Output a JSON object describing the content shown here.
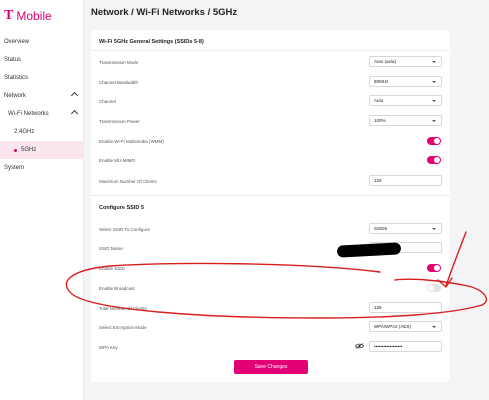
{
  "brand": {
    "logo_mark": "T",
    "name": "Mobile",
    "color": "#e20074"
  },
  "page": {
    "title": "Network / Wi-Fi Networks / 5GHz"
  },
  "sidebar": {
    "items": [
      {
        "label": "Overview"
      },
      {
        "label": "Status"
      },
      {
        "label": "Statistics"
      },
      {
        "label": "Network",
        "expanded": true
      },
      {
        "label": "Wi-Fi Networks",
        "expanded": true
      },
      {
        "label": "2.4GHz"
      },
      {
        "label": "5GHz",
        "active": true
      },
      {
        "label": "System"
      }
    ]
  },
  "general": {
    "title": "Wi-Fi 5GHz General Settings (SSIDs 5-8)",
    "transmission_mode": {
      "label": "Transmission Mode",
      "value": "Auto (ax/a)"
    },
    "channel_bandwidth": {
      "label": "Channel Bandwidth",
      "value": "80MHz"
    },
    "channel": {
      "label": "Channel",
      "value": "Auto"
    },
    "transmission_power": {
      "label": "Transmission Power",
      "value": "100%"
    },
    "wmm": {
      "label": "Enable Wi-Fi Multimedia (WMM)",
      "enabled": true
    },
    "mu_mimo": {
      "label": "Enable MU-MIMO",
      "enabled": true
    },
    "max_clients": {
      "label": "Maximum Number Of Clients",
      "value": "128"
    }
  },
  "ssid": {
    "title": "Configure SSID 5",
    "select_ssid": {
      "label": "Select SSID To Configure",
      "value": "SSID5"
    },
    "ssid_name": {
      "label": "SSID Name",
      "value": ""
    },
    "enable_ssid": {
      "label": "Enable SSID",
      "enabled": true
    },
    "enable_broadcast": {
      "label": "Enable Broadcast",
      "enabled": false
    },
    "total_clients": {
      "label": "Total Number Of Clients",
      "value": "128"
    },
    "encryption": {
      "label": "Select Encryption Mode",
      "value": "WPA/WPA2 (AES)"
    },
    "wpa_key": {
      "label": "WPA Key",
      "value": "••••••••••••••••••"
    }
  },
  "actions": {
    "save_label": "Save Changes"
  },
  "annotation": {
    "color": "#d81e1e"
  }
}
